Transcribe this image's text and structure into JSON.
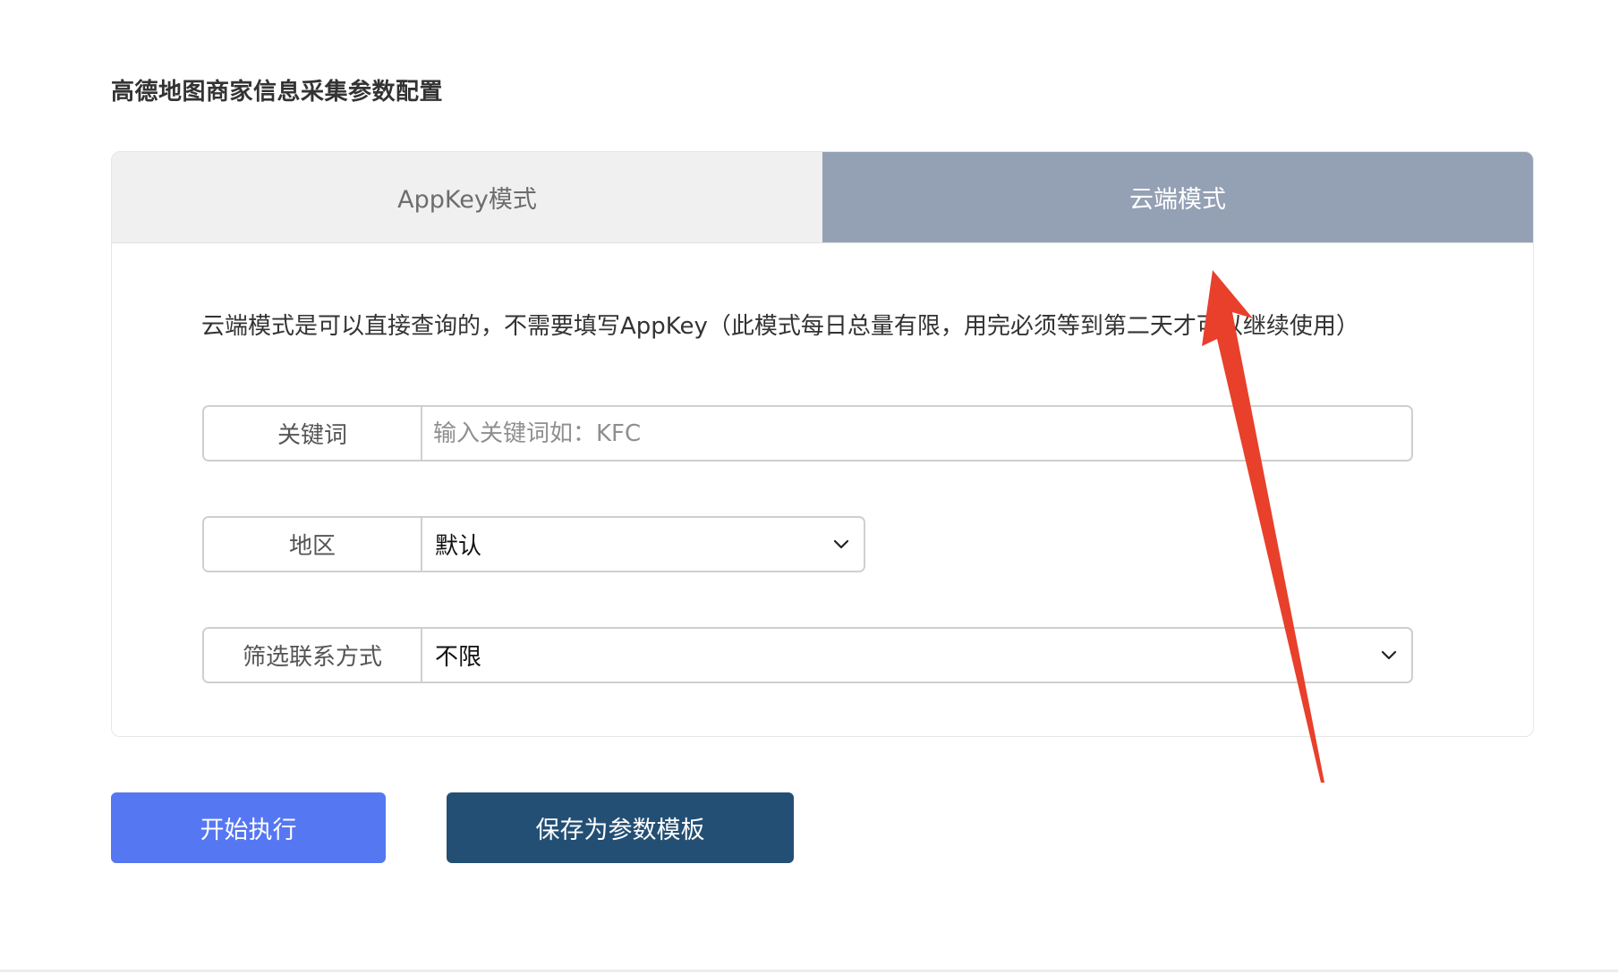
{
  "page": {
    "title": "高德地图商家信息采集参数配置"
  },
  "tabs": [
    {
      "label": "AppKey模式",
      "active": false
    },
    {
      "label": "云端模式",
      "active": true
    }
  ],
  "notice": "云端模式是可以直接查询的，不需要填写AppKey（此模式每日总量有限，用完必须等到第二天才可以继续使用）",
  "form": {
    "keyword": {
      "label": "关键词",
      "value": "",
      "placeholder": "输入关键词如：KFC"
    },
    "region": {
      "label": "地区",
      "selected": "默认"
    },
    "contact_filter": {
      "label": "筛选联系方式",
      "selected": "不限"
    }
  },
  "buttons": {
    "start": "开始执行",
    "save_template": "保存为参数模板"
  },
  "colors": {
    "active_tab": "#94a0b4",
    "inactive_tab": "#f0f0f0",
    "start_button": "#5677f2",
    "save_button": "#234f74",
    "annotation_arrow": "#e8402b"
  },
  "icons": {
    "select_indicator": "chevron-down-icon",
    "annotation": "red-arrow-annotation"
  }
}
